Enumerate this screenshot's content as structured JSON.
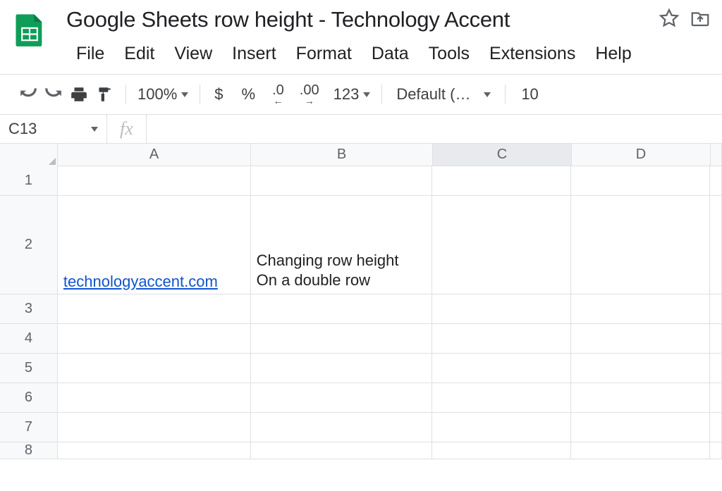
{
  "doc": {
    "title": "Google Sheets row height - Technology Accent"
  },
  "menu": {
    "file": "File",
    "edit": "Edit",
    "view": "View",
    "insert": "Insert",
    "format": "Format",
    "data": "Data",
    "tools": "Tools",
    "extensions": "Extensions",
    "help": "Help"
  },
  "toolbar": {
    "zoom": "100%",
    "currency": "$",
    "percent": "%",
    "dec_dec": ".0",
    "inc_dec": ".00",
    "num_fmt": "123",
    "font": "Default (Ari...",
    "font_size": "10"
  },
  "formula": {
    "name_box": "C13",
    "fx": "fx",
    "value": ""
  },
  "columns": [
    "A",
    "B",
    "C",
    "D"
  ],
  "rows": [
    "1",
    "2",
    "3",
    "4",
    "5",
    "6",
    "7",
    "8"
  ],
  "cells": {
    "A2": "technologyaccent.com",
    "B2": "Changing row height\nOn a double row"
  }
}
